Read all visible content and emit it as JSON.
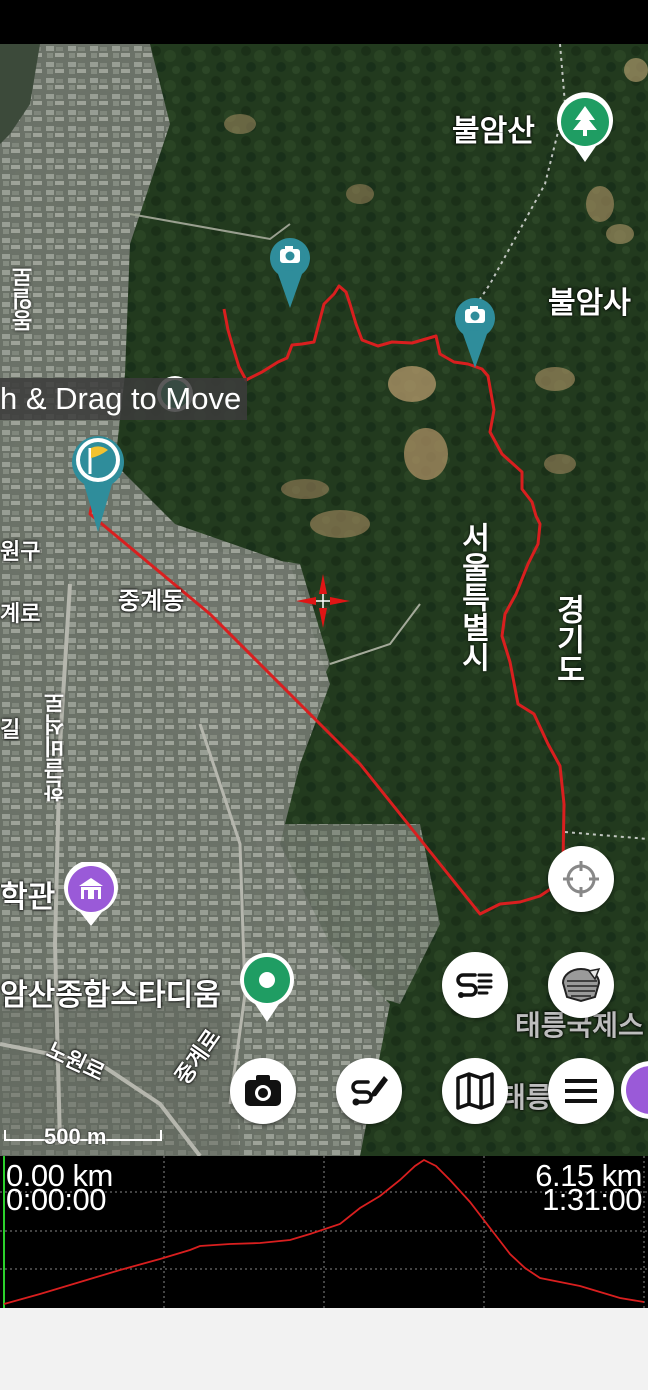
{
  "toast": {
    "text": "h & Drag to Move"
  },
  "map_labels": {
    "bulamsan": "불암산",
    "bulamsa": "불암사",
    "seoul": "서울특별시",
    "gyeonggi": "경기도",
    "junggye": "중계동",
    "stadium": "암산종합스타디움",
    "hakgwan": "학관",
    "nowonro": "노원로",
    "junggyero": "중계로",
    "hangeulbiseokro": "한글비석로",
    "gyero": "계로",
    "wongu": "원구",
    "dongilro": "동일로",
    "gil": "길",
    "taereung": "태릉국제스",
    "taereung2": "태릉"
  },
  "scale": {
    "label": "500 m"
  },
  "profile": {
    "start_distance": "0.00 km",
    "start_time": "0:00:00",
    "end_distance": "6.15 km",
    "end_time": "1:31:00"
  },
  "colors": {
    "track": "#d91f1f",
    "marker": "#2f8d9b",
    "poi_purple": "#9a5ad8",
    "poi_green": "#1f9d63"
  },
  "icons": {
    "camera_fab": "camera-icon",
    "route_edit_fab": "route-edit-icon",
    "map_fab": "map-icon",
    "menu_fab": "menu-icon",
    "route_list_fab": "route-list-icon",
    "layers_fab": "layers-icon",
    "locate_fab": "crosshair-icon"
  }
}
